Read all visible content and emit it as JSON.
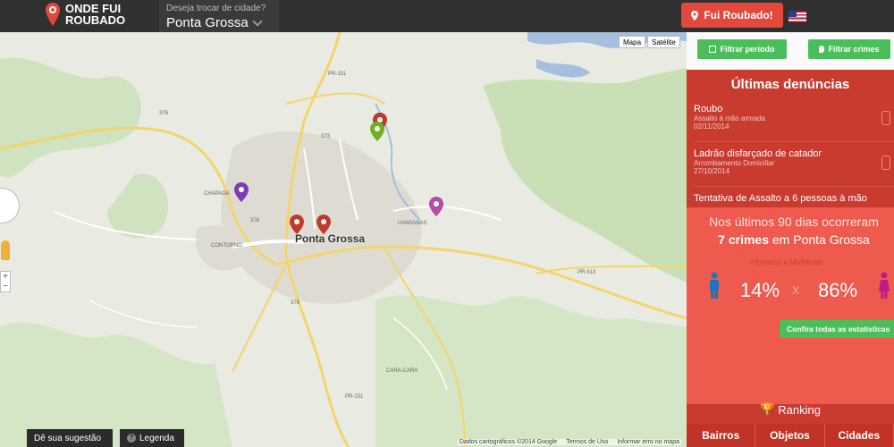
{
  "header": {
    "logo_line1": "ONDE FUI",
    "logo_line2": "ROUBADO",
    "city_question": "Deseja trocar de cidade?",
    "city_name": "Ponta Grossa",
    "robbed_button": "Fui Roubado!",
    "flag_icon": "us-flag-icon"
  },
  "map": {
    "maptype_map": "Mapa",
    "maptype_satellite": "Satélite",
    "city_label": "Ponta Grossa",
    "footer": [
      "Dados cartográficos ©2014 Google",
      "Termos de Uso",
      "Informar erro no mapa"
    ],
    "suggest_button": "Dê sua sugestão",
    "legend_button": "Legenda",
    "place_labels": [
      "CHAPADA",
      "CONTORNO",
      "UVARANAS",
      "CARA-CARA"
    ],
    "road_labels": [
      "PR-151",
      "376",
      "373",
      "PR-513",
      "PR-151",
      "376",
      "376"
    ],
    "markers": [
      {
        "color": "#c0392b",
        "name": "red-marker"
      },
      {
        "color": "#6bb120",
        "name": "green-marker"
      },
      {
        "color": "#7d3cb5",
        "name": "purple-marker"
      },
      {
        "color": "#b54aa8",
        "name": "magenta-marker"
      },
      {
        "color": "#c0392b",
        "name": "red-marker"
      },
      {
        "color": "#c0392b",
        "name": "red-marker"
      }
    ]
  },
  "sidebar": {
    "filter_period": "Filtrar período",
    "filter_crimes": "Filtrar crimes",
    "latest_title": "Últimas denúncias",
    "reports": [
      {
        "title": "Roubo",
        "subtitle": "Assalto à mão armada",
        "date": "02/11/2014"
      },
      {
        "title": "Ladrão disfarçado de catador",
        "subtitle": "Arrombamento Domiciliar",
        "date": "27/10/2014"
      },
      {
        "title": "Tentativa de Assalto a 6 pessoas à mão",
        "subtitle": "",
        "date": ""
      }
    ],
    "stats_line1": "Nos últimos 90 dias ocorreram",
    "stats_count": "7 crimes",
    "stats_city": "em Ponta Grossa",
    "gender_label": "Homens x Mulheres",
    "men_pct": "14%",
    "x_sep": "x",
    "women_pct": "86%",
    "confira_button": "Confira todas as estatísticas",
    "ranking_title": "Ranking",
    "ranking_tabs": [
      "Bairros",
      "Objetos",
      "Cidades"
    ],
    "colors": {
      "accent": "#c93a2f",
      "green": "#4bbd5a",
      "men": "#1e73be",
      "women": "#c2188a"
    }
  }
}
